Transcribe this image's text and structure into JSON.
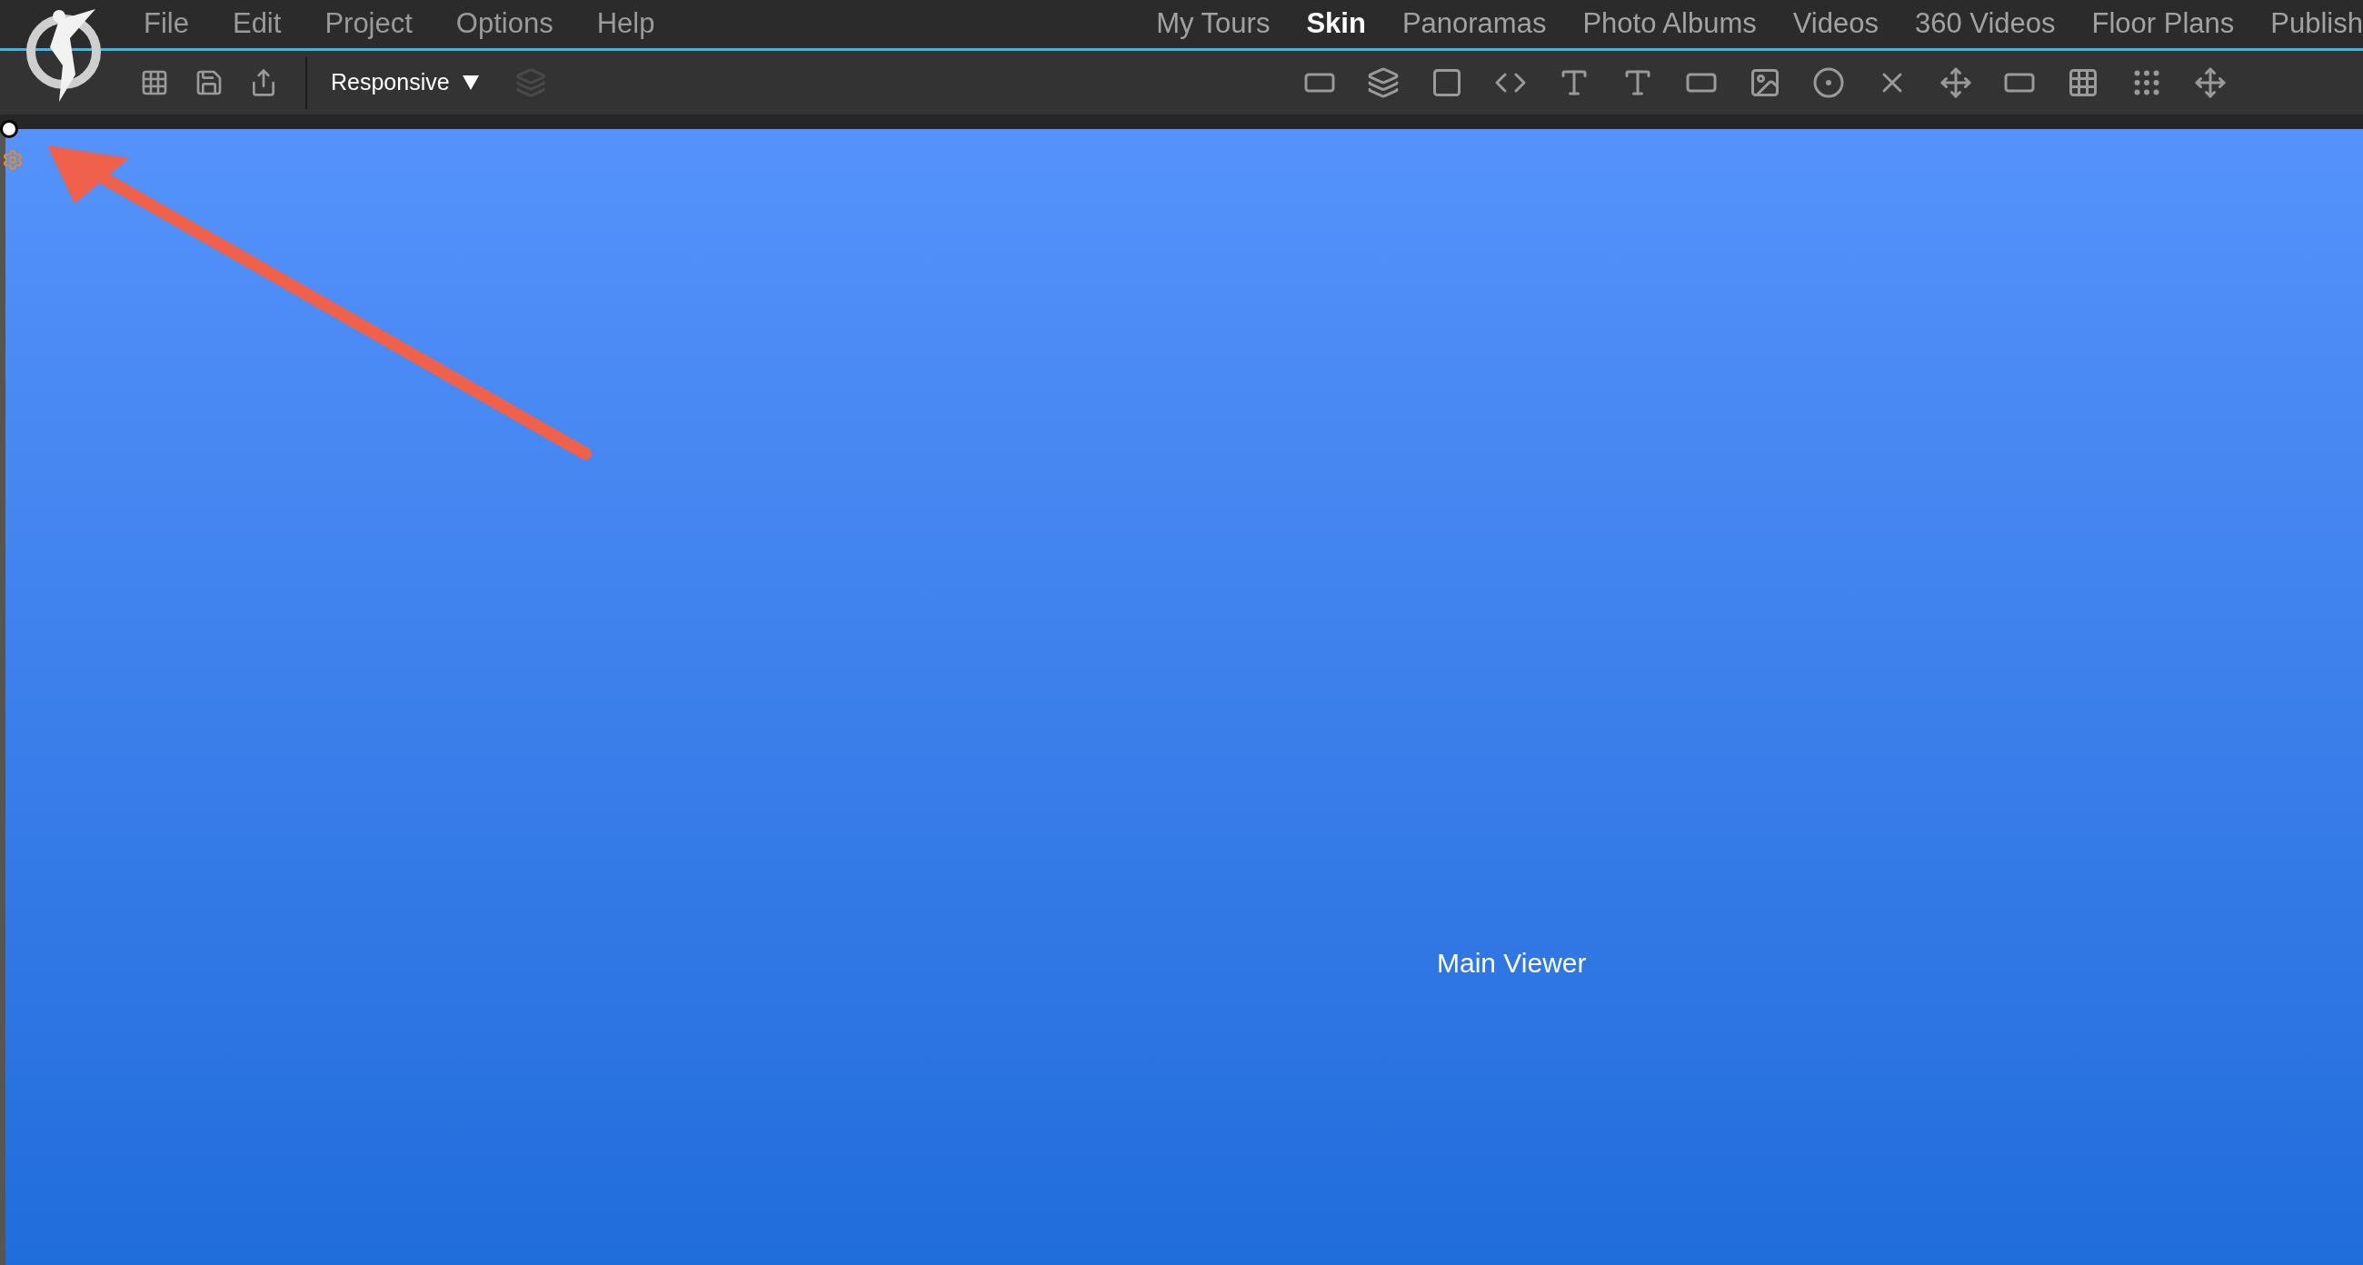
{
  "menu": [
    {
      "label": "File"
    },
    {
      "label": "Edit"
    },
    {
      "label": "Project"
    },
    {
      "label": "Options"
    },
    {
      "label": "Help"
    }
  ],
  "tabs": [
    {
      "label": "My Tours",
      "selected": false
    },
    {
      "label": "Skin",
      "selected": true
    },
    {
      "label": "Panoramas",
      "selected": false
    },
    {
      "label": "Photo Albums",
      "selected": false
    },
    {
      "label": "Videos",
      "selected": false
    },
    {
      "label": "360 Videos",
      "selected": false
    },
    {
      "label": "Floor Plans",
      "selected": false
    },
    {
      "label": "Publish",
      "selected": false
    }
  ],
  "toolbar": {
    "mode_dropdown": {
      "value": "Responsive"
    }
  },
  "viewer": {
    "label": "Main Viewer"
  }
}
